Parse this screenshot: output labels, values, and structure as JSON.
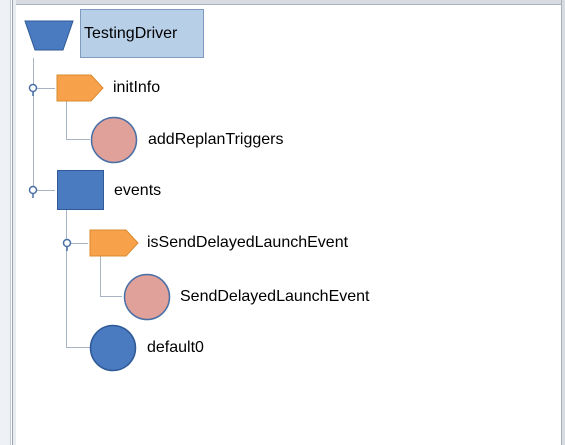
{
  "tree": {
    "root": {
      "label": "TestingDriver",
      "icon": "trapezoid-icon",
      "color": "#4a7abf",
      "selected": true
    },
    "nodes": {
      "init_info": {
        "label": "initInfo",
        "icon": "tag-icon",
        "color": "#f7a14a",
        "expanded": true
      },
      "add_replan_triggers": {
        "label": "addReplanTriggers",
        "icon": "circle-icon",
        "color": "#e0a19a"
      },
      "events": {
        "label": "events",
        "icon": "square-icon",
        "color": "#4a7abf",
        "expanded": true
      },
      "is_send_delayed_launch_event": {
        "label": "isSendDelayedLaunchEvent",
        "icon": "tag-icon",
        "color": "#f7a14a",
        "expanded": true
      },
      "send_delayed_launch_event": {
        "label": "SendDelayedLaunchEvent",
        "icon": "circle-icon",
        "color": "#e0a19a"
      },
      "default0": {
        "label": "default0",
        "icon": "circle-icon",
        "color": "#4a7abf"
      }
    }
  }
}
